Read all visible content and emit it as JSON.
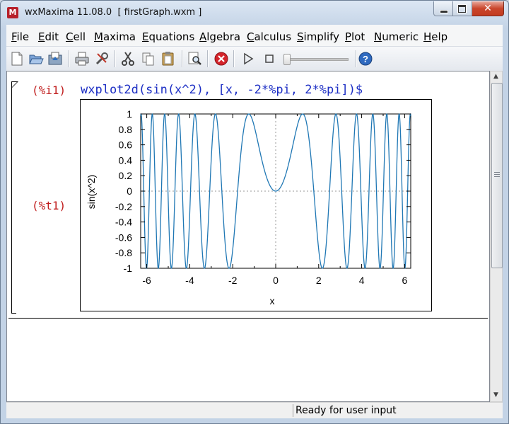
{
  "window": {
    "app_name": "wxMaxima 11.08.0",
    "document_title": "[ firstGraph.wxm ]"
  },
  "menu": [
    {
      "label": "File",
      "key": "F",
      "rest": "ile"
    },
    {
      "label": "Edit",
      "key": "E",
      "rest": "dit"
    },
    {
      "label": "Cell",
      "key": "C",
      "rest": "ell"
    },
    {
      "label": "Maxima",
      "key": "M",
      "rest": "axima"
    },
    {
      "label": "Equations",
      "key": "E",
      "rest": "quations"
    },
    {
      "label": "Algebra",
      "key": "A",
      "rest": "lgebra"
    },
    {
      "label": "Calculus",
      "key": "C",
      "rest": "alculus"
    },
    {
      "label": "Simplify",
      "key": "S",
      "rest": "implify"
    },
    {
      "label": "Plot",
      "key": "P",
      "rest": "lot"
    },
    {
      "label": "Numeric",
      "key": "N",
      "rest": "umeric"
    },
    {
      "label": "Help",
      "key": "H",
      "rest": "elp"
    }
  ],
  "toolbar": {
    "items": [
      "new-file-icon",
      "open-file-icon",
      "save-file-icon",
      "print-icon",
      "preferences-icon",
      "cut-icon",
      "copy-icon",
      "paste-icon",
      "find-icon",
      "interrupt-icon",
      "play-icon",
      "stop-icon",
      "animation-slider",
      "help-icon"
    ],
    "slider_value": 0
  },
  "cell": {
    "input_label": "(%i1)",
    "input_text": "wxplot2d(sin(x^2), [x, -2*%pi, 2*%pi])$",
    "output_label": "(%t1)"
  },
  "colors": {
    "input_label": "#c01d1d",
    "input_text": "#1c2ec4",
    "plot_line": "#1f77b4"
  },
  "chart_data": {
    "type": "line",
    "function": "sin(x^2)",
    "x_range": [
      -6.2832,
      6.2832
    ],
    "xlim": [
      -6.2832,
      6.2832
    ],
    "ylim": [
      -1,
      1
    ],
    "xlabel": "x",
    "ylabel": "sin(x^2)",
    "x_ticks": [
      -6,
      -4,
      -2,
      0,
      2,
      4,
      6
    ],
    "y_ticks": [
      1,
      0.8,
      0.6,
      0.4,
      0.2,
      0,
      -0.2,
      -0.4,
      -0.6,
      -0.8,
      -1
    ],
    "zero_axes": true,
    "grid": false,
    "legend": "none"
  },
  "status": {
    "text": "Ready for user input"
  }
}
